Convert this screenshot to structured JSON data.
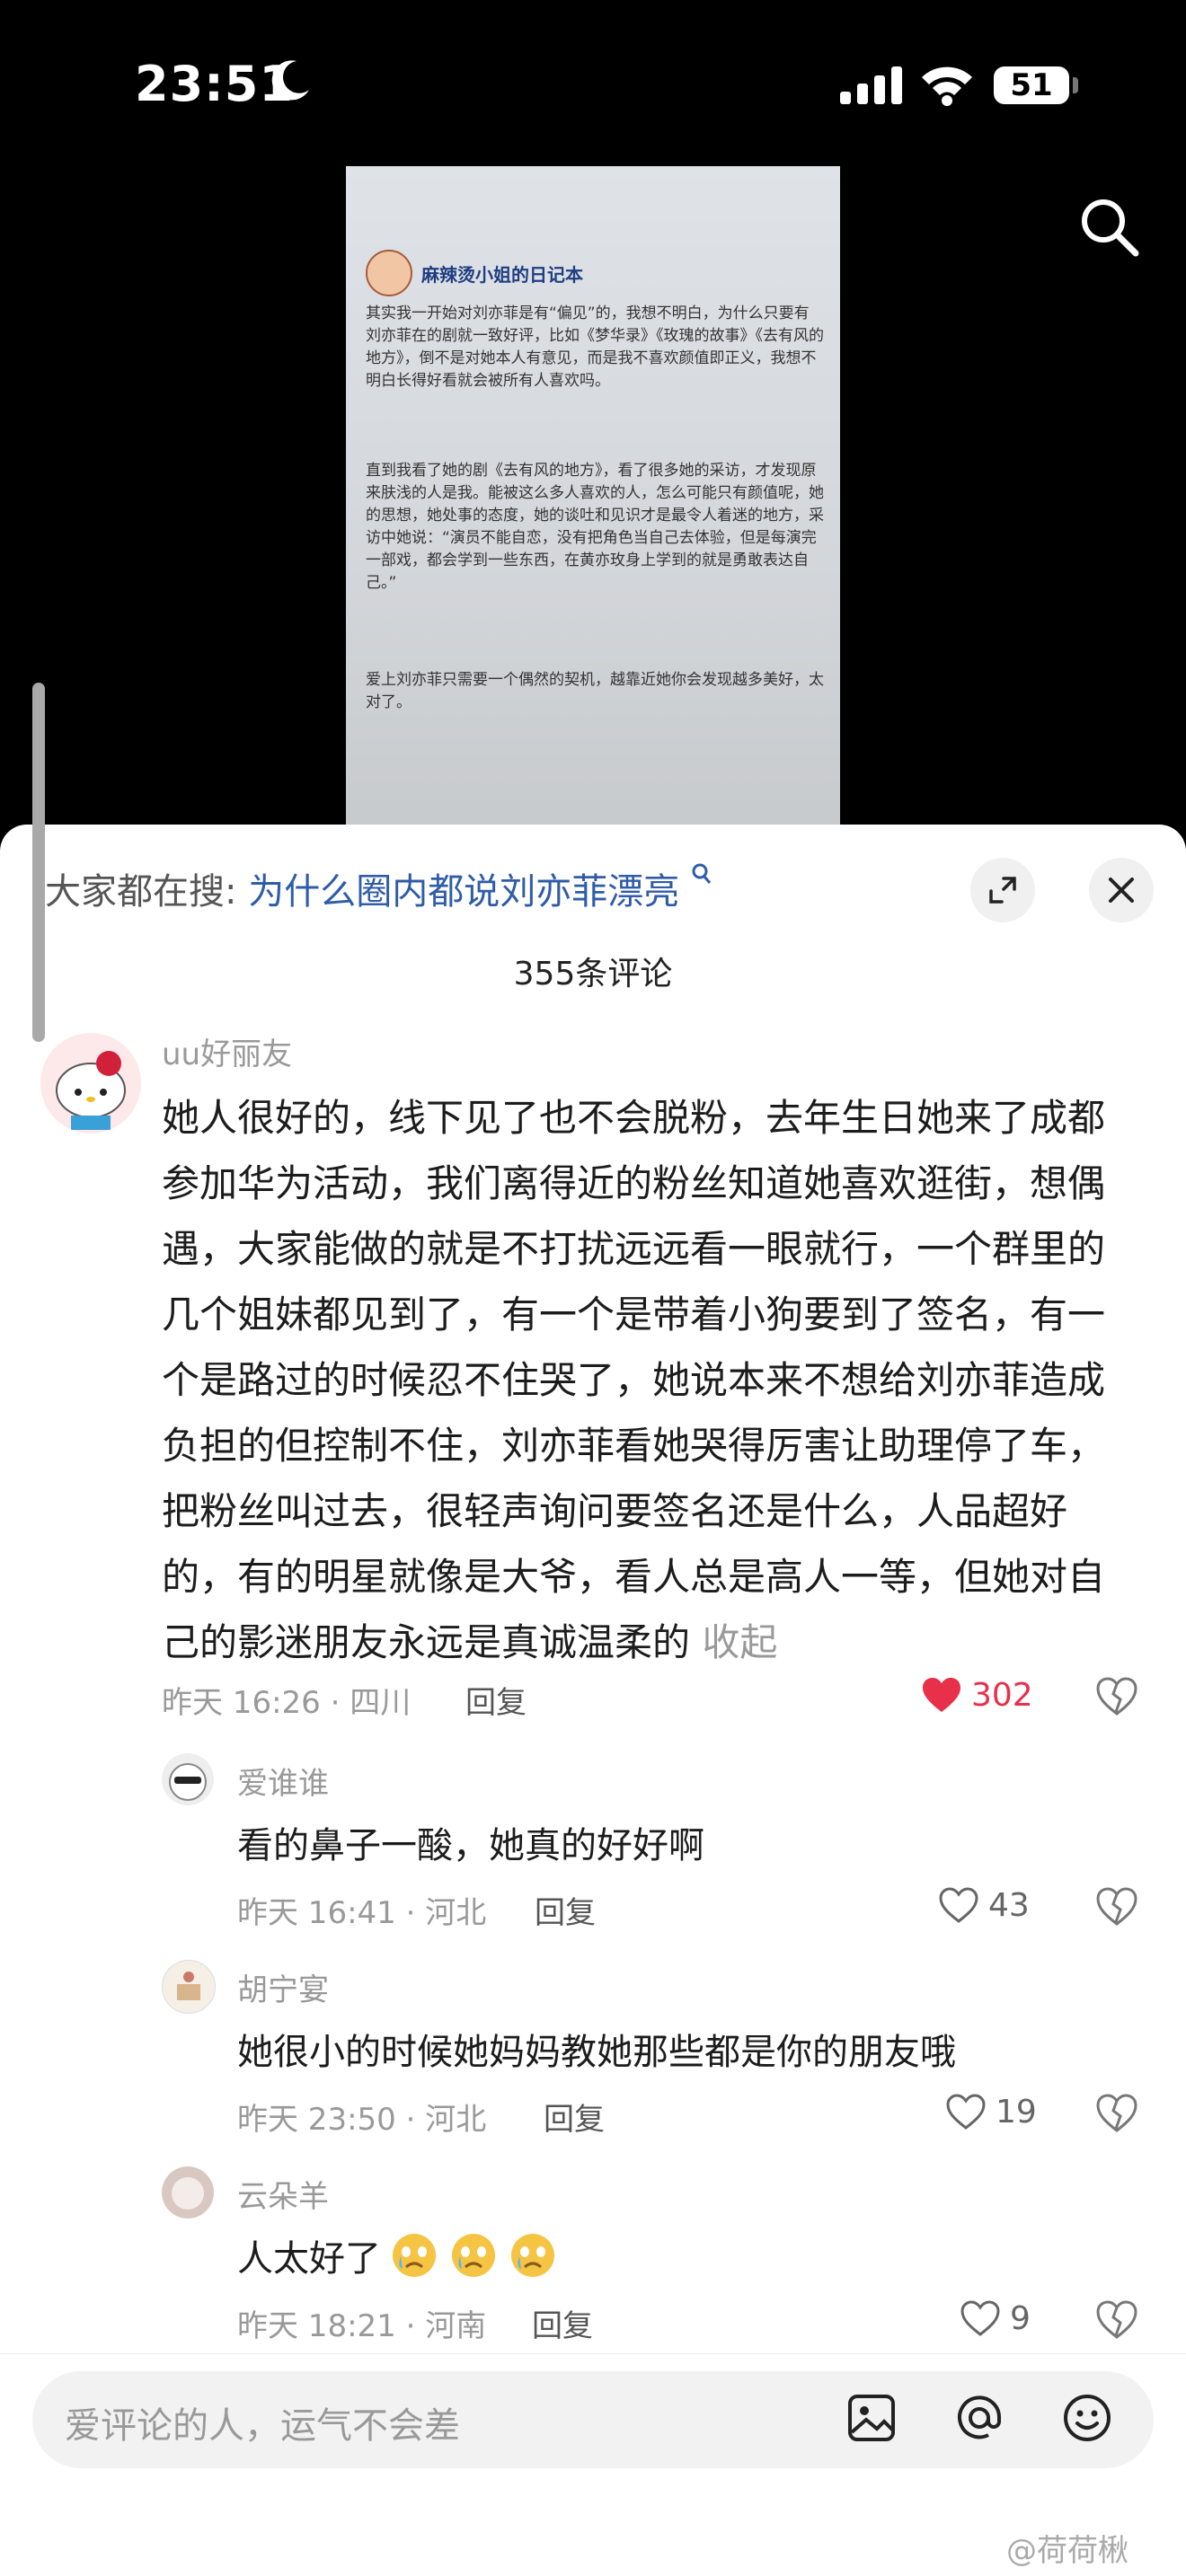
{
  "status": {
    "time": "23:51",
    "battery": "51"
  },
  "media": {
    "author": "麻辣烫小姐的日记本",
    "paragraphs": [
      "其实我一开始对刘亦菲是有“偏见”的，我想不明白，为什么只要有刘亦菲在的剧就一致好评，比如《梦华录》《玫瑰的故事》《去有风的地方》，倒不是对她本人有意见，而是我不喜欢颜值即正义，我想不明白长得好看就会被所有人喜欢吗。",
      "直到我看了她的剧《去有风的地方》，看了很多她的采访，才发现原来肤浅的人是我。能被这么多人喜欢的人，怎么可能只有颜值呢，她的思想，她处事的态度，她的谈吐和见识才是最令人着迷的地方，采访中她说：“演员不能自恋，没有把角色当自己去体验，但是每演完一部戏，都会学到一些东西，在黄亦玫身上学到的就是勇敢表达自己。”",
      "爱上刘亦菲只需要一个偶然的契机，越靠近她你会发现越多美好，太对了。"
    ]
  },
  "sheet": {
    "search_prefix": "大家都在搜:",
    "search_query": "为什么圈内都说刘亦菲漂亮",
    "comment_count": "355条评论"
  },
  "comments": [
    {
      "user": "uu好丽友",
      "text": "她人很好的，线下见了也不会脱粉，去年生日她来了成都参加华为活动，我们离得近的粉丝知道她喜欢逛街，想偶遇，大家能做的就是不打扰远远看一眼就行，一个群里的几个姐妹都见到了，有一个是带着小狗要到了签名，有一个是路过的时候忍不住哭了，她说本来不想给刘亦菲造成负担的但控制不住，刘亦菲看她哭得厉害让助理停了车，把粉丝叫过去，很轻声询问要签名还是什么，人品超好的，有的明星就像是大爷，看人总是高人一等，但她对自己的影迷朋友永远是真诚温柔的",
      "fold": "收起",
      "meta": "昨天 16:26 · 四川",
      "reply": "回复",
      "likes": "302"
    }
  ],
  "replies": [
    {
      "user": "爱谁谁",
      "text": "看的鼻子一酸，她真的好好啊",
      "meta": "昨天 16:41 · 河北",
      "reply": "回复",
      "likes": "43"
    },
    {
      "user": "胡宁宴",
      "text": "她很小的时候她妈妈教她那些都是你的朋友哦",
      "meta": "昨天 23:50 · 河北",
      "reply": "回复",
      "likes": "19"
    },
    {
      "user": "云朵羊",
      "text": "人太好了",
      "meta": "昨天 18:21 · 河南",
      "reply": "回复",
      "likes": "9"
    }
  ],
  "input": {
    "placeholder": "爱评论的人，运气不会差"
  },
  "watermark": "@荷荷楸"
}
